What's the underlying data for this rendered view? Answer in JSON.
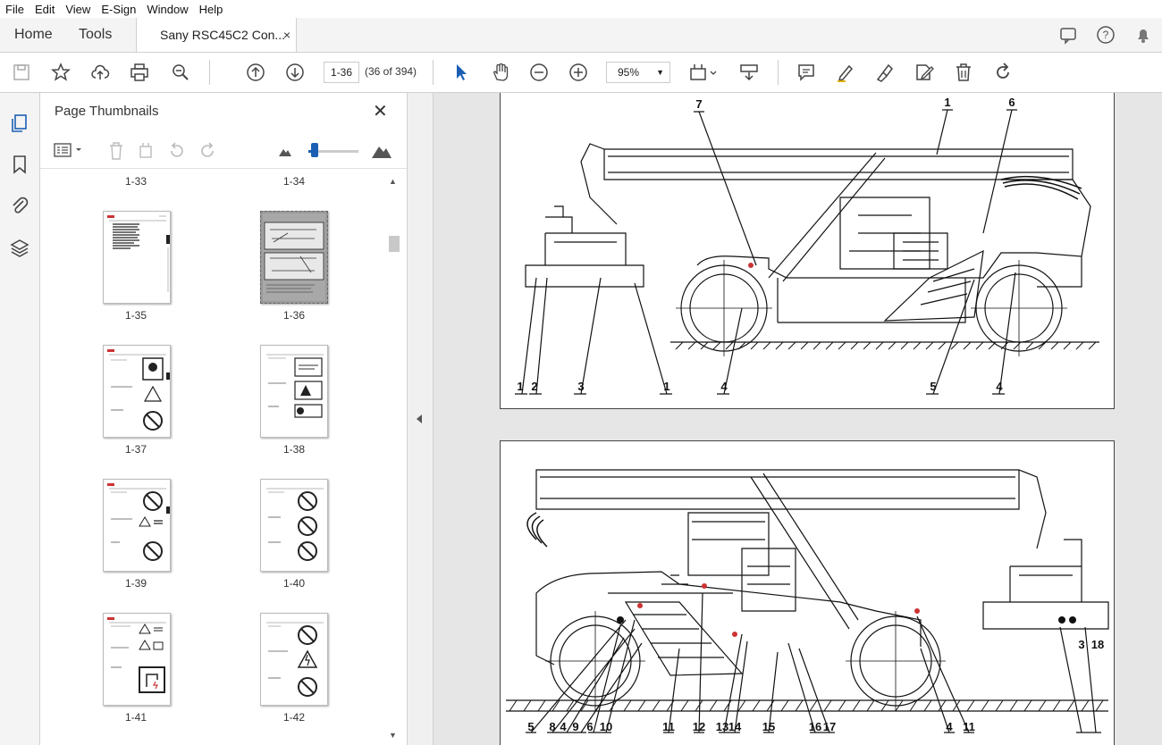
{
  "menu": [
    "File",
    "Edit",
    "View",
    "E-Sign",
    "Window",
    "Help"
  ],
  "tabs": {
    "home": "Home",
    "tools": "Tools",
    "document": "Sany RSC45C2 Con...",
    "close": "×"
  },
  "toolbar": {
    "page_input": "1-36",
    "page_count": "(36 of 394)",
    "zoom": "95%",
    "zoom_caret": "▼"
  },
  "panel": {
    "title": "Page Thumbnails",
    "close": "✕",
    "thumbnails": [
      {
        "label": "1-33"
      },
      {
        "label": "1-34"
      },
      {
        "label": "1-35"
      },
      {
        "label": "1-36"
      },
      {
        "label": "1-37"
      },
      {
        "label": "1-38"
      },
      {
        "label": "1-39"
      },
      {
        "label": "1-40"
      },
      {
        "label": "1-41"
      },
      {
        "label": "1-42"
      }
    ]
  },
  "drawing_top": {
    "callouts": [
      "7",
      "1",
      "6",
      "1",
      "2",
      "3",
      "1",
      "4",
      "5",
      "4"
    ]
  },
  "drawing_bottom": {
    "callouts": [
      "5",
      "8",
      "4",
      "9",
      "6",
      "10",
      "11",
      "12",
      "13",
      "14",
      "15",
      "16",
      "17",
      "4",
      "11",
      "3",
      "18"
    ]
  }
}
